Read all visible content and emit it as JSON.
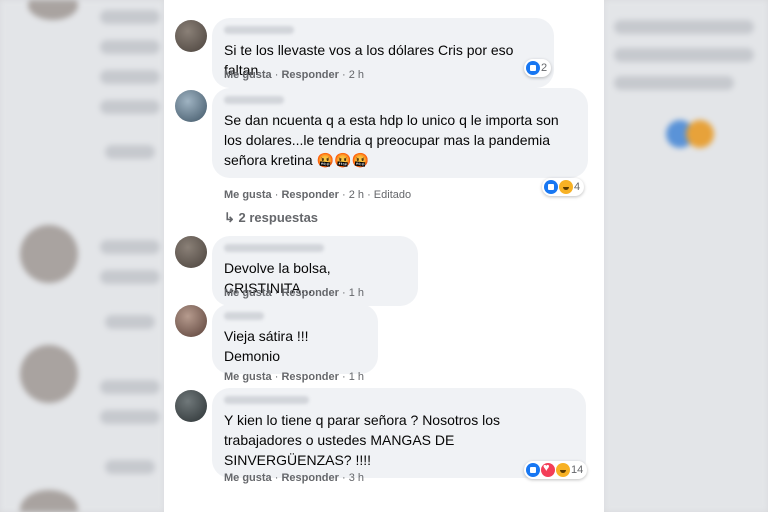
{
  "comments": [
    {
      "text": "Si te los llevaste vos a los dólares Cris por eso faltan",
      "like": "Me gusta",
      "reply": "Responder",
      "time": "2 h",
      "reactions_count": "2"
    },
    {
      "text": "Se dan ncuenta q a esta hdp lo unico q le importa son los dolares...le tendria q preocupar mas la pandemia señora kretina",
      "emoji": "🤬🤬🤬",
      "like": "Me gusta",
      "reply": "Responder",
      "time": "2 h",
      "edited": "Editado",
      "reactions_count": "4",
      "replies_label": "2 respuestas"
    },
    {
      "text": "Devolve la bolsa, CRISTINITA...",
      "like": "Me gusta",
      "reply": "Responder",
      "time": "1 h"
    },
    {
      "text": "Vieja sátira !!! Demonio",
      "like": "Me gusta",
      "reply": "Responder",
      "time": "1 h"
    },
    {
      "text": "Y kien lo tiene q parar señora ? Nosotros los trabajadores o ustedes MANGAS DE SINVERGÜENZAS? !!!!",
      "like": "Me gusta",
      "reply": "Responder",
      "time": "3 h",
      "reactions_count": "14"
    }
  ],
  "colors": {
    "bubble": "#f0f2f5",
    "meta_text": "#65676b",
    "like_blue": "#1877f2",
    "haha_yellow": "#f7b125",
    "love_red": "#f33e58"
  }
}
